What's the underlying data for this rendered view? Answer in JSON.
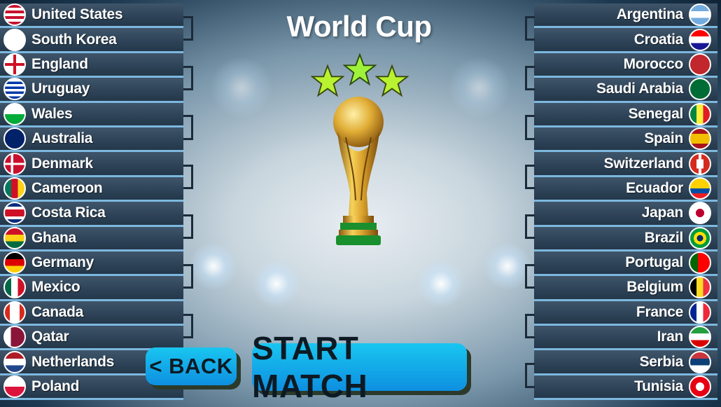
{
  "title": "World Cup",
  "left_teams": [
    {
      "name": "United States",
      "flag": "usa-flag-icon"
    },
    {
      "name": "South Korea",
      "flag": "south-korea-flag-icon"
    },
    {
      "name": "England",
      "flag": "england-flag-icon"
    },
    {
      "name": "Uruguay",
      "flag": "uruguay-flag-icon"
    },
    {
      "name": "Wales",
      "flag": "wales-flag-icon"
    },
    {
      "name": "Australia",
      "flag": "australia-flag-icon"
    },
    {
      "name": "Denmark",
      "flag": "denmark-flag-icon"
    },
    {
      "name": "Cameroon",
      "flag": "cameroon-flag-icon"
    },
    {
      "name": "Costa Rica",
      "flag": "costa-rica-flag-icon"
    },
    {
      "name": "Ghana",
      "flag": "ghana-flag-icon"
    },
    {
      "name": "Germany",
      "flag": "germany-flag-icon"
    },
    {
      "name": "Mexico",
      "flag": "mexico-flag-icon"
    },
    {
      "name": "Canada",
      "flag": "canada-flag-icon"
    },
    {
      "name": "Qatar",
      "flag": "qatar-flag-icon"
    },
    {
      "name": "Netherlands",
      "flag": "netherlands-flag-icon"
    },
    {
      "name": "Poland",
      "flag": "poland-flag-icon"
    }
  ],
  "right_teams": [
    {
      "name": "Argentina",
      "flag": "argentina-flag-icon"
    },
    {
      "name": "Croatia",
      "flag": "croatia-flag-icon"
    },
    {
      "name": "Morocco",
      "flag": "morocco-flag-icon"
    },
    {
      "name": "Saudi Arabia",
      "flag": "saudi-arabia-flag-icon"
    },
    {
      "name": "Senegal",
      "flag": "senegal-flag-icon"
    },
    {
      "name": "Spain",
      "flag": "spain-flag-icon"
    },
    {
      "name": "Switzerland",
      "flag": "switzerland-flag-icon"
    },
    {
      "name": "Ecuador",
      "flag": "ecuador-flag-icon"
    },
    {
      "name": "Japan",
      "flag": "japan-flag-icon"
    },
    {
      "name": "Brazil",
      "flag": "brazil-flag-icon"
    },
    {
      "name": "Portugal",
      "flag": "portugal-flag-icon"
    },
    {
      "name": "Belgium",
      "flag": "belgium-flag-icon"
    },
    {
      "name": "France",
      "flag": "france-flag-icon"
    },
    {
      "name": "Iran",
      "flag": "iran-flag-icon"
    },
    {
      "name": "Serbia",
      "flag": "serbia-flag-icon"
    },
    {
      "name": "Tunisia",
      "flag": "tunisia-flag-icon"
    }
  ],
  "trophy": {
    "icon": "world-cup-trophy-icon",
    "stars": 3
  },
  "buttons": {
    "back_label": "< BACK",
    "start_label": "START MATCH"
  },
  "colors": {
    "accent": "#0fb3ea",
    "row_bg": "#2d4256",
    "row_border": "#7db8de"
  }
}
